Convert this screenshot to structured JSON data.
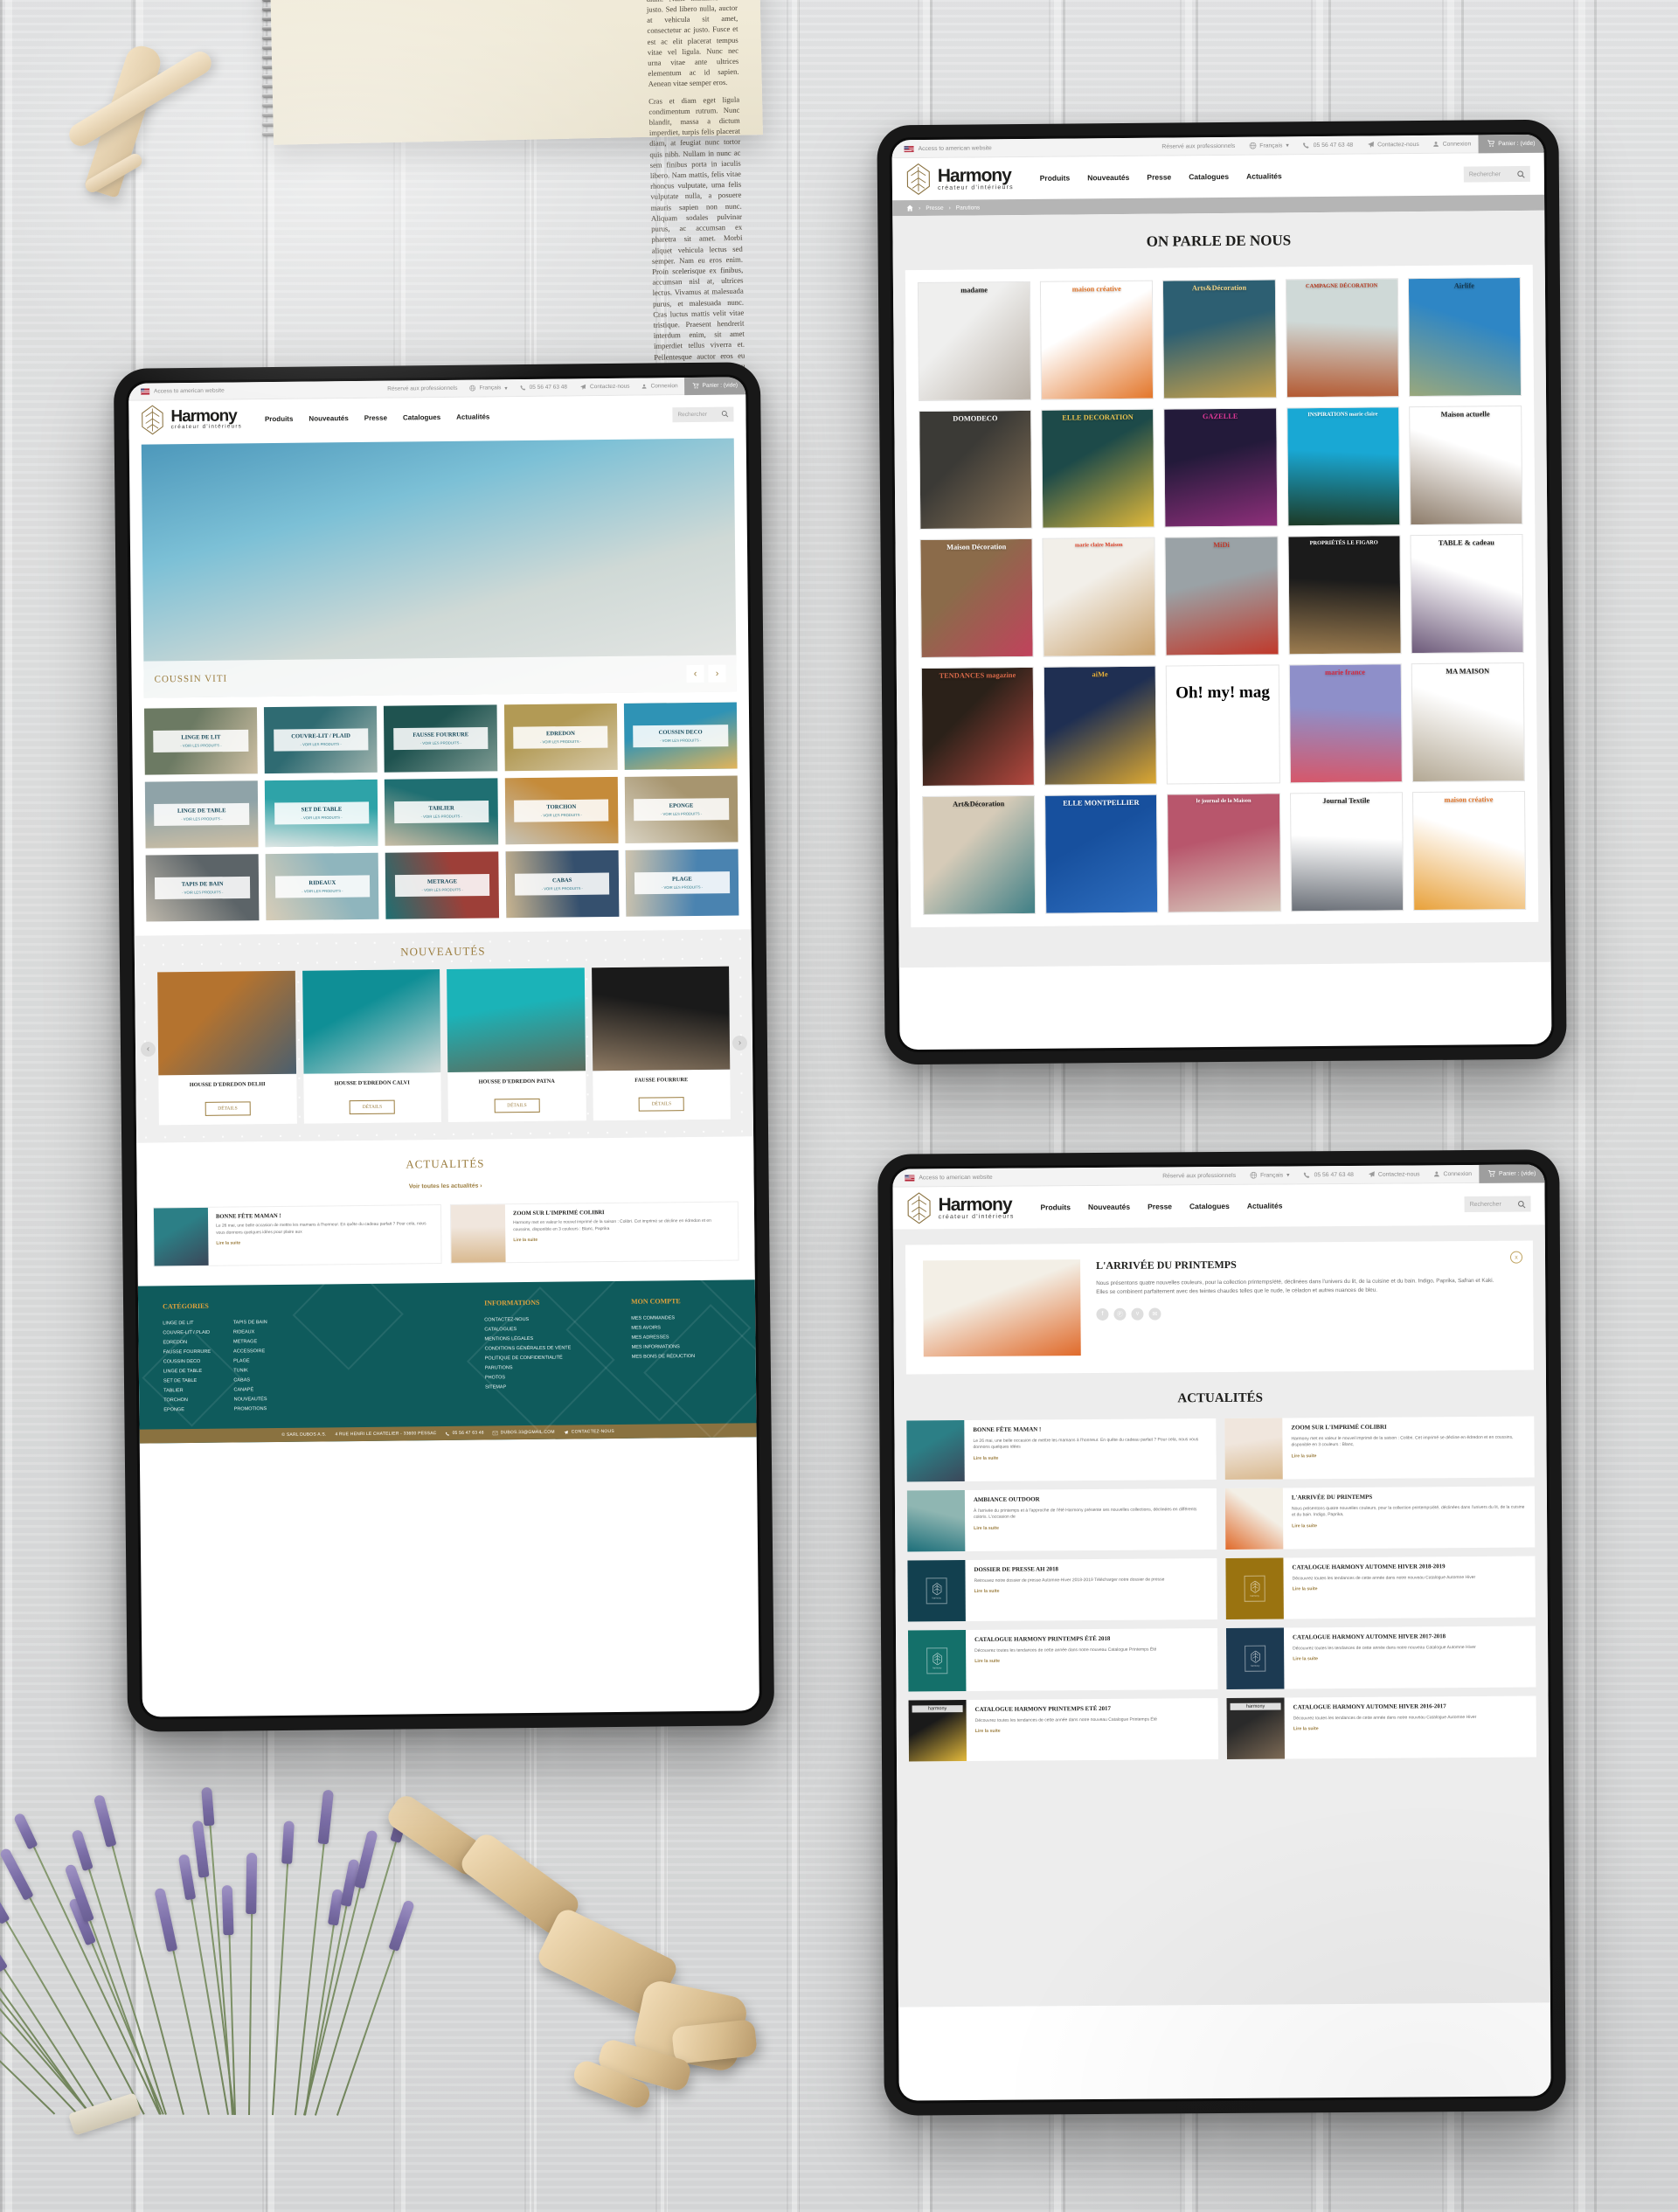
{
  "scene": {
    "title": "Harmony créateur d'intérieurs — responsive website mockup on three tablets",
    "background": "whitewashed wood planks",
    "props": [
      "spiral notebook with latin text",
      "wooden toy airplane",
      "dried lavender bunch",
      "wooden mannequin hand"
    ],
    "notebook_text": [
      "Class aptent taciti sociosqu ad litora torquent per conubia nostra, per inceptos himenaeos. Nulla eget condimentum ligula. Etiam at magna imperdiet nunc posuere volutpat quis placerat metus. Curabitur sollicitudin sollicitudin est, quis ultricies diam. Nunc maximus odio justo. Sed libero nulla, auctor at vehicula sit amet, consectetur ac justo. Fusce et est ac elit placerat tempus vitae vel ligula. Nunc nec urna vitae ante ultrices elementum ac id sapien. Aenean vitae semper eros.",
      "Cras et diam eget ligula condimentum rutrum. Nunc blandit, massa a dictum imperdiet, turpis felis placerat diam, at feugiat nunc tortor quis nibh. Nullam in nunc ac sem finibus porta in iaculis libero. Nam mattis, felis vitae rhoncus vulputate, urna felis vulputate nulla, a posuere mauris sapien non nunc. Aliquam sodales pulvinar purus, ac accumsan ex pharetra sit amet. Morbi aliquet vehicula lectus sed semper. Nam eu eros enim. Proin scelerisque ex finibus, accumsan nisl at, ultrices lectus. Vivamus at malesuada purus, et malesuada nunc. Cras luctus mattis velit vitae tristique. Praesent hendrerit interdum enim, sit amet imperdiet tellus viverra et. Pellentesque auctor eros eu ante tempus mollis. Nunc eu metus vel turpis gravida dictum."
    ]
  },
  "colors": {
    "teal": "#0f5b5c",
    "gold": "#9b7d3f",
    "gold_bar": "#8a7240",
    "footer_heading": "#e0a23c",
    "plate_text": "#17495a",
    "topbar_bg": "#f3f3f3",
    "cart_bg": "#9e9e9e",
    "breadcrumb_bg": "#b5b5b5"
  },
  "topbar": {
    "american_link": "Access to american website",
    "flag_icon": "us-flag-icon",
    "pro_link": "Réservé aux professionnels",
    "globe_icon": "globe-icon",
    "language": "Français",
    "chevron": "▾",
    "phone_icon": "phone-icon",
    "phone": "05 56 47 63 48",
    "contact_icon": "paper-plane-icon",
    "contact": "Contactez-nous",
    "user_icon": "user-icon",
    "login": "Connexion",
    "cart_icon": "cart-icon",
    "cart": "Panier : (vide)"
  },
  "brand": {
    "name": "Harmony",
    "tagline": "créateur d'intérieurs",
    "mark": "leaf-lozenge-logo"
  },
  "nav": {
    "items": [
      {
        "label": "Produits"
      },
      {
        "label": "Nouveautés"
      },
      {
        "label": "Presse"
      },
      {
        "label": "Catalogues"
      },
      {
        "label": "Actualités"
      }
    ],
    "search_placeholder": "Rechercher",
    "search_icon": "search-icon"
  },
  "home": {
    "hero": {
      "caption": "COUSSIN VITI",
      "prev": "‹",
      "next": "›"
    },
    "categories": [
      {
        "label": "LINGE DE LIT",
        "sub": "- VOIR LES PRODUITS -",
        "c1": "#6c7a63",
        "c2": "#cdbfa3"
      },
      {
        "label": "COUVRE-LIT / PLAID",
        "sub": "- VOIR LES PRODUITS -",
        "c1": "#2f6b72",
        "c2": "#9fb3ad"
      },
      {
        "label": "FAUSSE FOURRURE",
        "sub": "- VOIR LES PRODUITS -",
        "c1": "#1f5350",
        "c2": "#7d9a92"
      },
      {
        "label": "EDREDON",
        "sub": "- VOIR LES PRODUITS -",
        "c1": "#b29a55",
        "c2": "#d6c9a8"
      },
      {
        "label": "COUSSIN DECO",
        "sub": "- VOIR LES PRODUITS -",
        "c1": "#2f93b5",
        "c2": "#e2b45a"
      },
      {
        "label": "LINGE DE TABLE",
        "sub": "- VOIR LES PRODUITS -",
        "c1": "#8fa3a8",
        "c2": "#cfc0a4"
      },
      {
        "label": "SET DE TABLE",
        "sub": "- VOIR LES PRODUITS -",
        "c1": "#2ea3a8",
        "c2": "#dde5e3"
      },
      {
        "label": "TABLIER",
        "sub": "- VOIR LES PRODUITS -",
        "c1": "#1f6f72",
        "c2": "#c9bda5"
      },
      {
        "label": "TORCHON",
        "sub": "- VOIR LES PRODUITS -",
        "c1": "#c58b3a",
        "c2": "#c6c3b7"
      },
      {
        "label": "EPONGE",
        "sub": "- VOIR LES PRODUITS -",
        "c1": "#a7956f",
        "c2": "#d8d2c2"
      },
      {
        "label": "TAPIS DE BAIN",
        "sub": "- VOIR LES PRODUITS -",
        "c1": "#5c6468",
        "c2": "#bdb7ab"
      },
      {
        "label": "RIDEAUX",
        "sub": "- VOIR LES PRODUITS -",
        "c1": "#8fb5bd",
        "c2": "#d8cdb8"
      },
      {
        "label": "METRAGE",
        "sub": "- VOIR LES PRODUITS -",
        "c1": "#9d3f38",
        "c2": "#1f6f72"
      },
      {
        "label": "CABAS",
        "sub": "- VOIR LES PRODUITS -",
        "c1": "#35506e",
        "c2": "#c8b490"
      },
      {
        "label": "PLAGE",
        "sub": "- VOIR LES PRODUITS -",
        "c1": "#4a83b0",
        "c2": "#cfc4ae"
      }
    ],
    "nouveautes": {
      "title": "NOUVEAUTÉS",
      "prev": "‹",
      "next": "›",
      "products": [
        {
          "name": "HOUSSE D'EDREDON DELHI",
          "button": "DÉTAILS",
          "c1": "#b4732f",
          "c2": "#4b5f6e"
        },
        {
          "name": "HOUSSE D'EDREDON CALVI",
          "button": "DÉTAILS",
          "c1": "#0f8f96",
          "c2": "#cfd8d6"
        },
        {
          "name": "HOUSSE D'EDREDON PATNA",
          "button": "DÉTAILS",
          "c1": "#1bb3b8",
          "c2": "#5c6b5c"
        },
        {
          "name": "FAUSSE FOURRURE",
          "button": "DÉTAILS",
          "c1": "#1a1a1a",
          "c2": "#8e7a63"
        }
      ]
    },
    "actualites": {
      "title": "ACTUALITÉS",
      "see_all": "Voir toutes les actualités ›",
      "items": [
        {
          "title": "BONNE FÊTE MAMAN !",
          "excerpt": "Le 26 mai, une belle occasion de mettre les mamans à l'honneur.  En quête du cadeau parfait ?  Pour cela, nous vous donnons quelques idées pour plaire aux",
          "more": "Lire la suite",
          "c1": "#2c7f86",
          "c2": "#3b4759"
        },
        {
          "title": "ZOOM SUR L'IMPRIMÉ COLIBRI",
          "excerpt": "Harmony met en valeur le nouvel imprimé de la saison : Colibri. Cet imprimé se décline en édredon et en coussins, disponible en 3 couleurs : Blanc, Paprika",
          "more": "Lire la suite",
          "c1": "#f0e6dd",
          "c2": "#d9b98f"
        }
      ]
    }
  },
  "footer": {
    "columns": [
      {
        "heading": "CATÉGORIES",
        "links_a": [
          "LINGE DE LIT",
          "COUVRE-LIT / PLAID",
          "EDREDON",
          "FAUSSE FOURRURE",
          "COUSSIN DECO",
          "LINGE DE TABLE",
          "SET DE TABLE",
          "TABLIER",
          "TORCHON",
          "EPONGE"
        ],
        "links_b": [
          "TAPIS DE BAIN",
          "RIDEAUX",
          "METRAGE",
          "ACCESSOIRE",
          "PLAGE",
          "TUNIK",
          "CABAS",
          "CANAPÉ",
          "NOUVEAUTÉS",
          "PROMOTIONS"
        ]
      },
      {
        "heading": "INFORMATIONS",
        "links_a": [
          "CONTACTEZ-NOUS",
          "CATALOGUES",
          "MENTIONS LÉGALES",
          "CONDITIONS GÉNÉRALES DE VENTE",
          "POLITIQUE DE CONFIDENTIALITÉ",
          "PARUTIONS",
          "PHOTOS",
          "SITEMAP"
        ]
      },
      {
        "heading": "MON COMPTE",
        "links_a": [
          "MES COMMANDES",
          "MES AVOIRS",
          "MES ADRESSES",
          "MES INFORMATIONS",
          "MES BONS DE RÉDUCTION"
        ]
      }
    ],
    "bottom": {
      "copyright": "© SARL DUBOS A.S.",
      "address": "4 RUE HENRI LE CHATELIER - 33600 PESSAC",
      "phone_icon": "phone-icon",
      "phone": "05 56 47 63 48",
      "mail_icon": "envelope-icon",
      "email": "DUBOS.33@GMAIL.COM",
      "contact_icon": "paper-plane-icon",
      "contact": "CONTACTEZ-NOUS"
    }
  },
  "press": {
    "breadcrumb": {
      "home_icon": "home-icon",
      "sep": "›",
      "items": [
        "Presse",
        "Parutions"
      ]
    },
    "title": "ON PARLE DE NOUS",
    "magazines": [
      {
        "name": "madame",
        "c1": "#efefee",
        "c2": "#b9b0a6",
        "tc": "#1d1d1b"
      },
      {
        "name": "maison créative",
        "c1": "#ffffff",
        "c2": "#e3762a",
        "tc": "#e3762a"
      },
      {
        "name": "Arts&Décoration",
        "c1": "#2d5f72",
        "c2": "#c8a14a",
        "tc": "#f0d58a"
      },
      {
        "name": "CAMPAGNE DÉCORATION",
        "c1": "#cfd9d7",
        "c2": "#b45a32",
        "tc": "#b5391f"
      },
      {
        "name": "Airlife",
        "c1": "#2e86c5",
        "c2": "#9aa87c",
        "tc": "#14374f"
      },
      {
        "name": "DOMODECO",
        "c1": "#3b3a36",
        "c2": "#8a7458",
        "tc": "#ffffff"
      },
      {
        "name": "ELLE DECORATION",
        "c1": "#1d4a49",
        "c2": "#e0b83a",
        "tc": "#e8c352"
      },
      {
        "name": "GAZELLE",
        "c1": "#231a3a",
        "c2": "#8e2f7a",
        "tc": "#e1399a"
      },
      {
        "name": "INSPIRATIONS marie claire",
        "c1": "#19a8d4",
        "c2": "#1c3a26",
        "tc": "#ffffff"
      },
      {
        "name": "Maison actuelle",
        "c1": "#ffffff",
        "c2": "#8d7c6a",
        "tc": "#1d1d1b"
      },
      {
        "name": "Maison Décoration",
        "c1": "#8b6b4a",
        "c2": "#c1425c",
        "tc": "#ffffff"
      },
      {
        "name": "marie claire Maison",
        "c1": "#f2efe9",
        "c2": "#c9a06a",
        "tc": "#e0452c"
      },
      {
        "name": "MiDi",
        "c1": "#9aa2a6",
        "c2": "#c0392b",
        "tc": "#c0392b"
      },
      {
        "name": "PROPRIÉTÉS LE FIGARO",
        "c1": "#1b1b1b",
        "c2": "#9c7c4f",
        "tc": "#ffffff"
      },
      {
        "name": "TABLE & cadeau",
        "c1": "#ffffff",
        "c2": "#6d5a7a",
        "tc": "#1d1d1b"
      },
      {
        "name": "TENDANCES magazine",
        "c1": "#2b2119",
        "c2": "#b5483f",
        "tc": "#d96a4a"
      },
      {
        "name": "aiMe",
        "c1": "#1f2f52",
        "c2": "#dca832",
        "tc": "#e8b23c"
      },
      {
        "name": "Oh! my! mag",
        "c1": "#ffffff",
        "c2": "#ffffff",
        "tc": "#000000"
      },
      {
        "name": "marie france",
        "c1": "#8e8fc9",
        "c2": "#d6576a",
        "tc": "#d6293f"
      },
      {
        "name": "MA MAISON",
        "c1": "#ffffff",
        "c2": "#b3a894",
        "tc": "#1d1d1b"
      },
      {
        "name": "Art&Décoration",
        "c1": "#d6cbb8",
        "c2": "#3f7f86",
        "tc": "#1d1d1b"
      },
      {
        "name": "ELLE MONTPELLIER",
        "c1": "#17509e",
        "c2": "#2f6fc0",
        "tc": "#ffffff"
      },
      {
        "name": "le journal de la Maison",
        "c1": "#b8566c",
        "c2": "#d8cabd",
        "tc": "#ffffff"
      },
      {
        "name": "Journal Textile",
        "c1": "#ffffff",
        "c2": "#6b7078",
        "tc": "#1d1d1b"
      },
      {
        "name": "maison créative",
        "c1": "#ffffff",
        "c2": "#e8a13a",
        "tc": "#e3762a"
      }
    ]
  },
  "news": {
    "article": {
      "close_icon": "close-icon",
      "close_label": "x",
      "title": "L'ARRIVÉE DU PRINTEMPS",
      "body": "Nous présentons quatre nouvelles couleurs, pour la collection printemps/été, déclinées dans l'univers du lit, de la cuisine et du bain. Indigo, Paprika, Safran et Kaki.\nElles se combinent parfaitement avec des teintes chaudes telles que le nude, le céladon et autres nuances de bleu.",
      "share": [
        {
          "icon": "facebook-icon",
          "glyph": "f"
        },
        {
          "icon": "pinterest-icon",
          "glyph": "Ⓟ"
        },
        {
          "icon": "twitter-icon",
          "glyph": "ᴠ"
        },
        {
          "icon": "email-icon",
          "glyph": "✉"
        }
      ],
      "c1": "#f3efe6",
      "c2": "#e06a2a"
    },
    "list_title": "ACTUALITÉS",
    "items": [
      {
        "title": "BONNE FÊTE MAMAN !",
        "excerpt": "Le 26 mai, une belle occasion de mettre les mamans à l'honneur.  En quête du cadeau parfait ?  Pour cela, nous vous donnons quelques idées",
        "more": "Lire la suite",
        "kind": "photo",
        "c1": "#2c7f86",
        "c2": "#3b4759"
      },
      {
        "title": "ZOOM SUR L'IMPRIMÉ COLIBRI",
        "excerpt": "Harmony met en valeur le nouvel imprimé de la saison : Colibri. Cet imprimé se décline en édredon et en coussins, disponible en 3 couleurs : Blanc,",
        "more": "Lire la suite",
        "kind": "photo",
        "c1": "#f0e6dd",
        "c2": "#d9b98f"
      },
      {
        "title": "AMBIANCE OUTDOOR",
        "excerpt": "À l'arrivée du printemps et à l'approche de l'été Harmony présente ses nouvelles collections, déclinées en différents coloris. L'occasion de",
        "more": "Lire la suite",
        "kind": "photo",
        "c1": "#8fb6b2",
        "c2": "#1d6f7a"
      },
      {
        "title": "L'ARRIVÉE DU PRINTEMPS",
        "excerpt": "Nous présentons quatre nouvelles couleurs, pour la collection printemps/été, déclinées dans l'univers du lit, de la cuisine et du bain. Indigo, Paprika,",
        "more": "Lire la suite",
        "kind": "photo",
        "c1": "#f3efe6",
        "c2": "#e06a2a"
      },
      {
        "title": "DOSSIER DE PRESSE AH 2018",
        "excerpt": "Retrouvez notre dossier de presse Automne-Hiver 2018-2019 Télécharger notre dossier de presse",
        "more": "Lire la suite",
        "kind": "logo",
        "c1": "#12404f",
        "c2": "#12404f"
      },
      {
        "title": "CATALOGUE HARMONY AUTOMNE HIVER 2018-2019",
        "excerpt": "Découvrez toutes les tendances de cette année dans notre nouveau Catalogue Automne Hiver",
        "more": "Lire la suite",
        "kind": "logo",
        "c1": "#9a7310",
        "c2": "#9a7310"
      },
      {
        "title": "CATALOGUE HARMONY PRINTEMPS ÉTÉ 2018",
        "excerpt": "Découvrez toutes les tendances de cette année dans notre nouveau Catalogue Printemps Été",
        "more": "Lire la suite",
        "kind": "logo",
        "c1": "#14706a",
        "c2": "#14706a"
      },
      {
        "title": "CATALOGUE HARMONY AUTOMNE HIVER 2017-2018",
        "excerpt": "Découvrez toutes les tendances de cette année dans notre nouveau Catalogue Automne Hiver",
        "more": "Lire la suite",
        "kind": "logo",
        "c1": "#1c3a52",
        "c2": "#1c3a52"
      },
      {
        "title": "CATALOGUE HARMONY PRINTEMPS ETÉ 2017",
        "excerpt": "Découvrez toutes les tendances de cette année dans notre nouveau Catalogue Printemps Été",
        "more": "Lire la suite",
        "kind": "cover",
        "c1": "#1a1a1a",
        "c2": "#e3b93a"
      },
      {
        "title": "CATALOGUE HARMONY AUTOMNE HIVER 2016-2017",
        "excerpt": "Découvrez toutes les tendances de cette année dans notre nouveau Catalogue Automne Hiver",
        "more": "Lire la suite",
        "kind": "cover",
        "c1": "#2a2a2a",
        "c2": "#7d6a55"
      }
    ],
    "catalogue_logo_word": "harmony"
  }
}
